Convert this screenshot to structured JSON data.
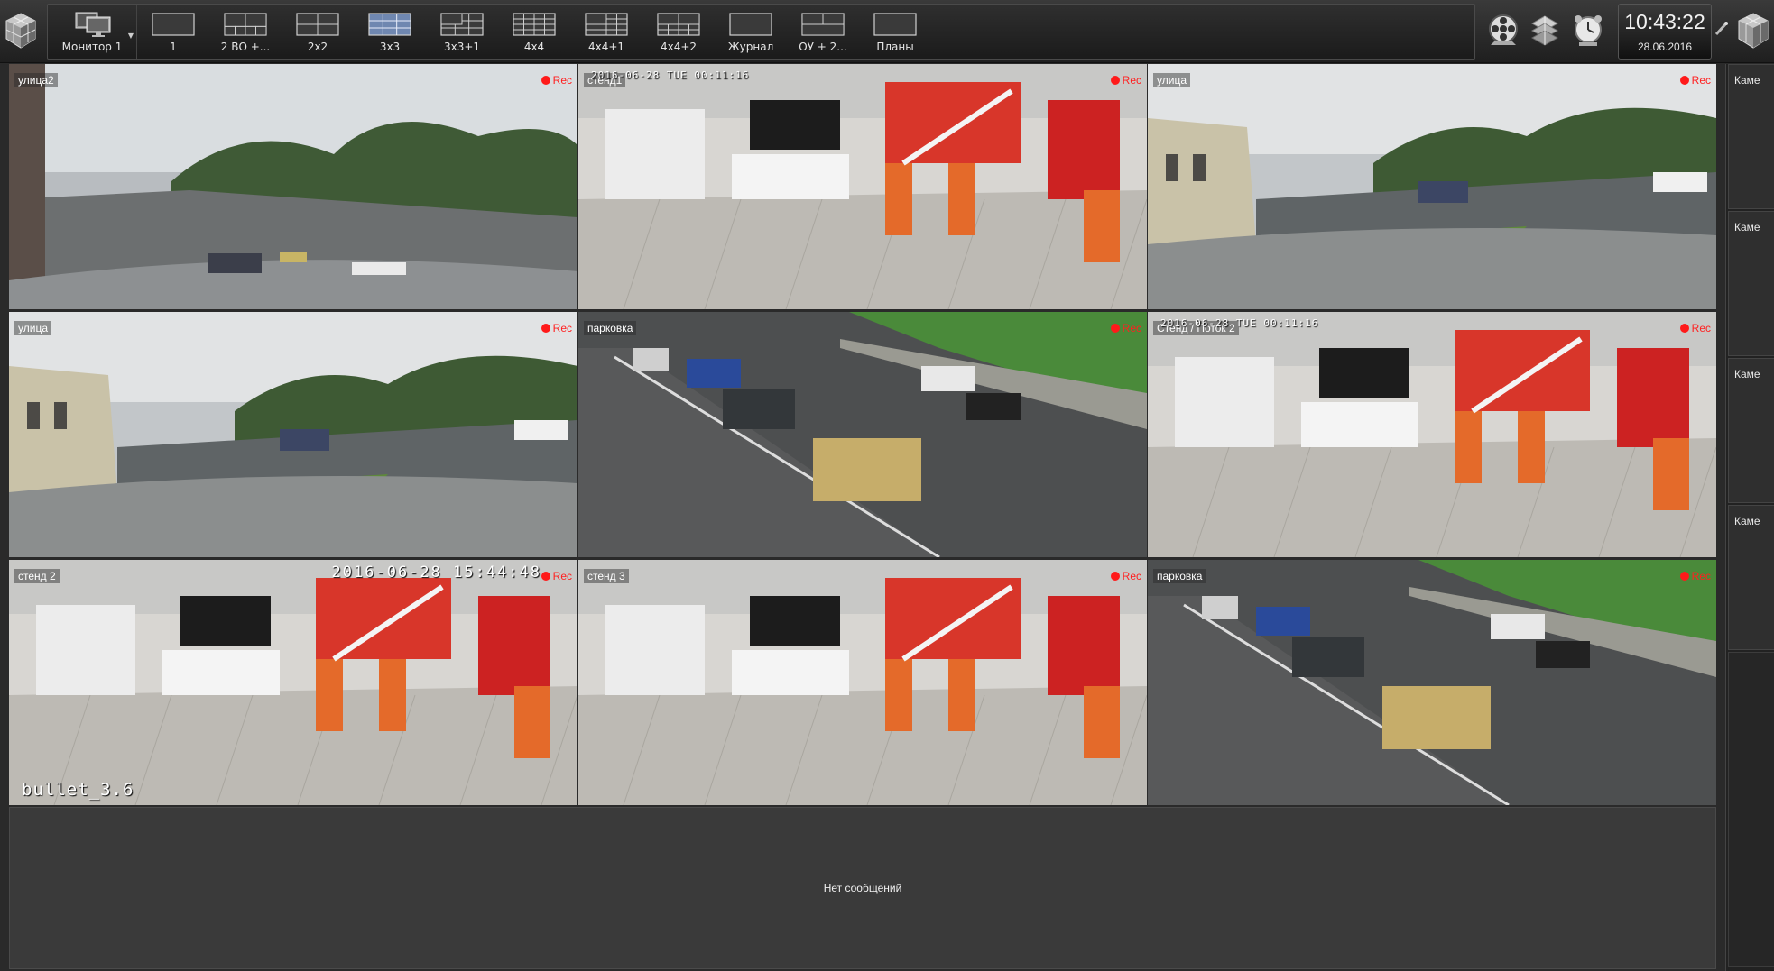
{
  "toolbar": {
    "monitor": {
      "label": "Монитор 1"
    },
    "layouts": [
      {
        "id": "1",
        "label": "1",
        "active": false
      },
      {
        "id": "2bo",
        "label": "2 ВО +...",
        "active": false
      },
      {
        "id": "2x2",
        "label": "2x2",
        "active": false
      },
      {
        "id": "3x3",
        "label": "3x3",
        "active": true
      },
      {
        "id": "3x3p1",
        "label": "3x3+1",
        "active": false
      },
      {
        "id": "4x4",
        "label": "4x4",
        "active": false
      },
      {
        "id": "4x4p1",
        "label": "4x4+1",
        "active": false
      },
      {
        "id": "4x4p2",
        "label": "4x4+2",
        "active": false
      },
      {
        "id": "journal",
        "label": "Журнал",
        "active": false
      },
      {
        "id": "ou2",
        "label": "ОУ + 2...",
        "active": false
      },
      {
        "id": "plans",
        "label": "Планы",
        "active": false
      }
    ],
    "clock": {
      "time": "10:43:22",
      "date": "28.06.2016"
    }
  },
  "cameras": [
    {
      "label": "улица2",
      "rec": "Rec",
      "scene": "street-wide"
    },
    {
      "label": "стенд1",
      "rec": "Rec",
      "scene": "store-1",
      "overlay": "2016-06-28 TUE 00:11:16"
    },
    {
      "label": "улица",
      "rec": "Rec",
      "scene": "street-window"
    },
    {
      "label": "улица",
      "rec": "Rec",
      "scene": "street-window"
    },
    {
      "label": "парковка",
      "rec": "Rec",
      "scene": "parking"
    },
    {
      "label": "Стенд / Поток 2",
      "rec": "Rec",
      "scene": "store-2",
      "overlay": "2016-06-28 TUE 00:11:16"
    },
    {
      "label": "стенд 2",
      "rec": "Rec",
      "scene": "store-3",
      "overlay_ts": "2016-06-28 15:44:48",
      "overlay_big": "bullet_3.6"
    },
    {
      "label": "стенд 3",
      "rec": "Rec",
      "scene": "store-4"
    },
    {
      "label": "парковка",
      "rec": "Rec",
      "scene": "parking"
    }
  ],
  "messages": {
    "empty_text": "Нет сообщений"
  },
  "right_panel": {
    "camera_items": [
      {
        "label": "Каме"
      },
      {
        "label": "Каме"
      },
      {
        "label": "Каме"
      },
      {
        "label": "Каме"
      }
    ]
  },
  "colors": {
    "rec": "#ff1a1a",
    "active_layout": "#6f87b0",
    "background": "#2a2a2a"
  }
}
